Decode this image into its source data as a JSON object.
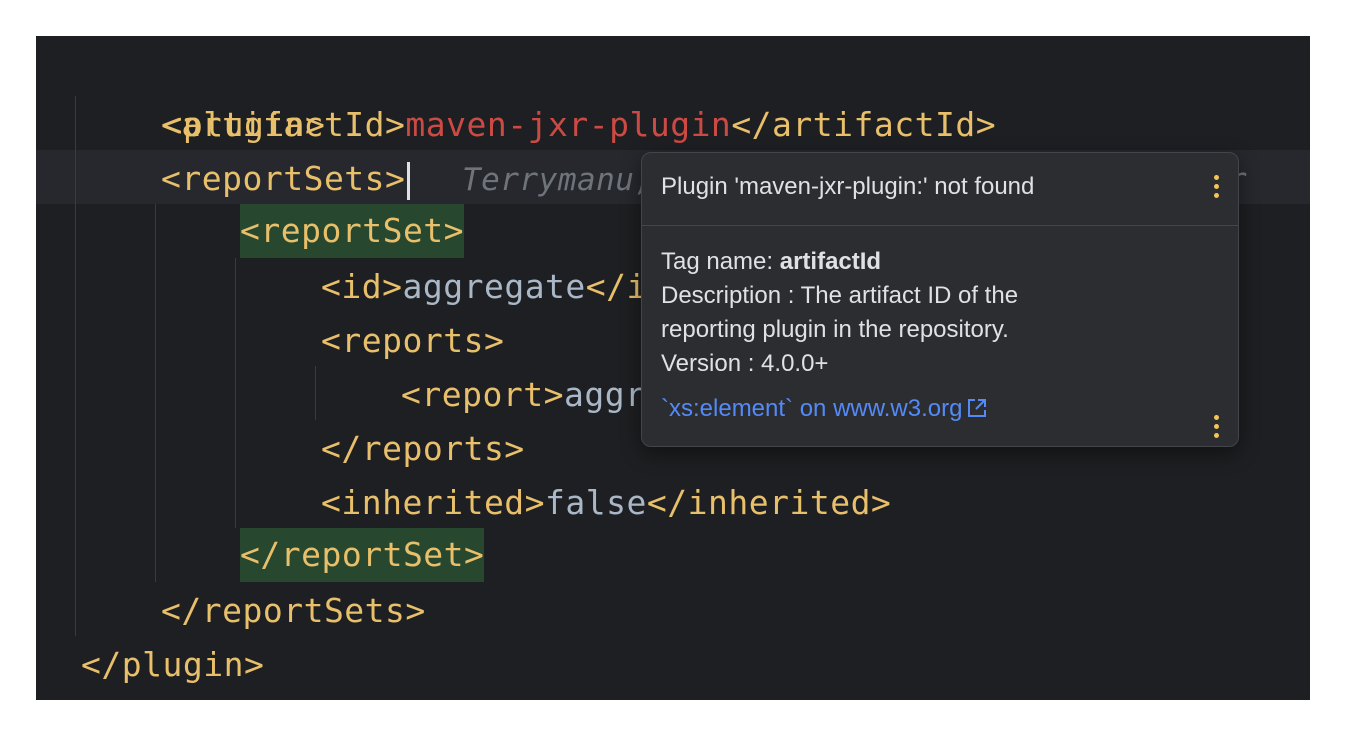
{
  "code": {
    "line1_open_plugin": "<plugin>",
    "line2_open_artifact": "<artifactId>",
    "line2_value": "maven-jxr-plugin",
    "line2_close_artifact": "</artifactId>",
    "line3_open_reportsets": "<reportSets>",
    "line3_inlay_hint": "Terrymanu,",
    "line3_inlay_tail": "r",
    "line4_open_reportset": "<reportSet>",
    "line5_open_id": "<id>",
    "line5_value": "aggregate",
    "line5_close_partial": "</i",
    "line6_open_reports": "<reports>",
    "line7_open_report": "<report>",
    "line7_value_partial": "aggr",
    "line8_close_reports": "</reports>",
    "line9_open_inherited": "<inherited>",
    "line9_value": "false",
    "line9_close_inherited": "</inherited>",
    "line10_close_reportset": "</reportSet>",
    "line11_close_reportsets": "</reportSets>",
    "line12_close_plugin": "</plugin>"
  },
  "popup": {
    "title": "Plugin 'maven-jxr-plugin:' not found",
    "tag_name_label": "Tag name: ",
    "tag_name_value": "artifactId",
    "description_line1": "Description : The artifact ID of the",
    "description_line2": "reporting plugin in the repository.",
    "version": "Version : 4.0.0+",
    "link_text": "`xs:element` on www.w3.org",
    "link_icon": "external-link-icon",
    "menu_icon": "more-vertical-icon"
  },
  "colors": {
    "editor_bg": "#1e1f22",
    "tag": "#e8bf6a",
    "string_red": "#cc4a44",
    "text_value": "#a9b7c6",
    "match_highlight": "#27472f",
    "popup_bg": "#2b2d30",
    "link": "#548af7",
    "kebab": "#f2c55c"
  }
}
